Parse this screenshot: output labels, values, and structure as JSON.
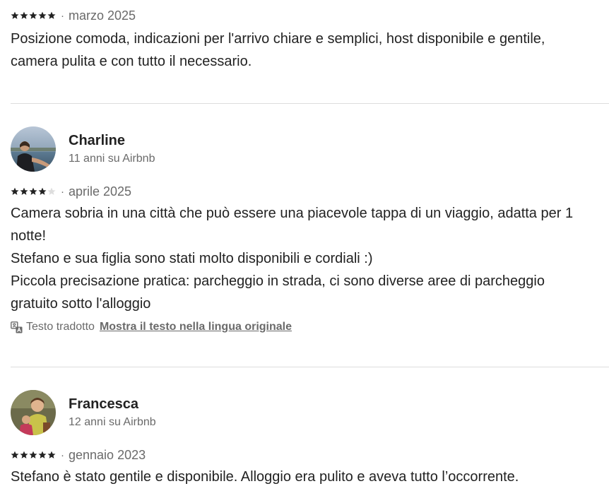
{
  "colors": {
    "text_primary": "#222222",
    "text_secondary": "#6a6a6a",
    "divider": "#dddddd",
    "star_filled": "#222222",
    "star_empty": "#dddddd"
  },
  "separator": "·",
  "reviews": [
    {
      "rating": 5,
      "date": "marzo 2025",
      "lines": [
        "Posizione comoda, indicazioni per l'arrivo chiare e semplici, host disponibile e gentile,",
        "camera pulita e con tutto il necessario."
      ]
    },
    {
      "name": "Charline",
      "tenure": "11 anni su Airbnb",
      "rating": 4,
      "date": "aprile 2025",
      "lines": [
        "Camera sobria in una città che può essere una piacevole tappa di un viaggio, adatta per 1",
        "notte!",
        "Stefano e sua figlia sono stati molto disponibili e cordiali :)",
        "Piccola precisazione pratica: parcheggio in strada, ci sono diverse aree di parcheggio",
        "gratuito sotto l'alloggio"
      ],
      "translated_label": "Testo tradotto",
      "show_original_label": "Mostra il testo nella lingua originale",
      "translate_icon": "translate-icon"
    },
    {
      "name": "Francesca",
      "tenure": "12 anni su Airbnb",
      "rating": 5,
      "date": "gennaio 2023",
      "lines": [
        "Stefano è stato gentile e disponibile. Alloggio era pulito e aveva tutto l’occorrente."
      ]
    }
  ]
}
